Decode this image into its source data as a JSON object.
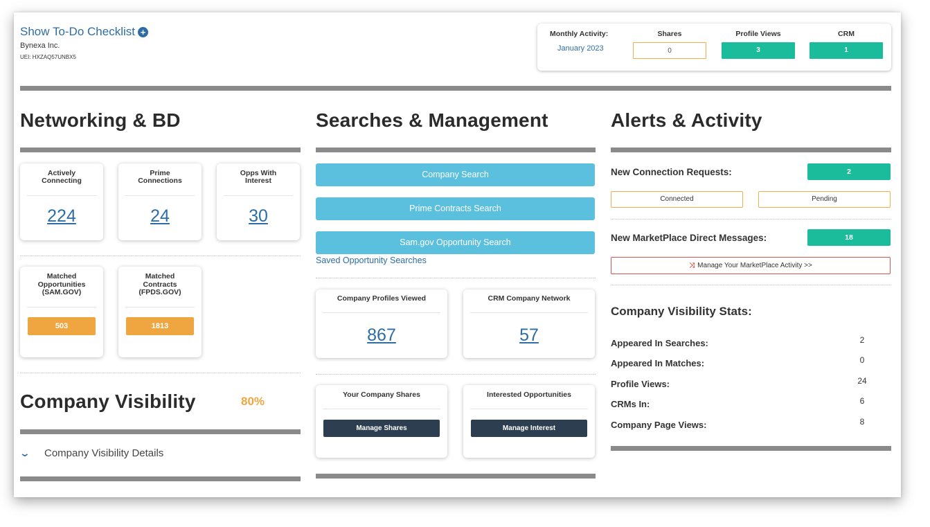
{
  "header": {
    "todo_label": "Show To-Do Checklist",
    "company_name": "Bynexa Inc.",
    "uei": "UEI: HXZAQ57UNBX5"
  },
  "monthly_activity": {
    "label": "Monthly Activity:",
    "month": "January 2023",
    "shares_label": "Shares",
    "shares_value": "0",
    "profile_views_label": "Profile Views",
    "profile_views_value": "3",
    "crm_label": "CRM",
    "crm_value": "1"
  },
  "networking": {
    "title": "Networking & BD",
    "cards": [
      {
        "title_l1": "Actively",
        "title_l2": "Connecting",
        "value": "224"
      },
      {
        "title_l1": "Prime",
        "title_l2": "Connections",
        "value": "24"
      },
      {
        "title_l1": "Opps With",
        "title_l2": "Interest",
        "value": "30"
      }
    ],
    "matched": [
      {
        "title_l1": "Matched",
        "title_l2": "Opportunities",
        "title_l3": "(SAM.GOV)",
        "value": "503"
      },
      {
        "title_l1": "Matched",
        "title_l2": "Contracts",
        "title_l3": "(FPDS.GOV)",
        "value": "1813"
      }
    ]
  },
  "visibility": {
    "title": "Company Visibility",
    "percent": "80%",
    "details_label": "Company Visibility Details"
  },
  "searches": {
    "title": "Searches & Management",
    "company_search": "Company Search",
    "prime_search": "Prime Contracts Search",
    "sam_search": "Sam.gov Opportunity Search",
    "saved_link": "Saved Opportunity Searches",
    "profiles_viewed_label": "Company Profiles Viewed",
    "profiles_viewed_value": "867",
    "crm_network_label": "CRM Company Network",
    "crm_network_value": "57",
    "shares_label": "Your Company Shares",
    "manage_shares": "Manage Shares",
    "interested_label": "Interested Opportunities",
    "manage_interest": "Manage Interest"
  },
  "alerts": {
    "title": "Alerts & Activity",
    "connection_requests_label": "New Connection Requests:",
    "connection_requests_value": "2",
    "connected_label": "Connected",
    "pending_label": "Pending",
    "messages_label": "New MarketPlace Direct Messages:",
    "messages_value": "18",
    "manage_marketplace": "Manage Your MarketPlace Activity >>",
    "stats_title": "Company Visibility Stats:",
    "stats": [
      {
        "label": "Appeared In Searches:",
        "value": "2"
      },
      {
        "label": "Appeared In Matches:",
        "value": "0"
      },
      {
        "label": "Profile Views:",
        "value": "24"
      },
      {
        "label": "CRMs In:",
        "value": "6"
      },
      {
        "label": "Company Page Views:",
        "value": "8"
      }
    ]
  },
  "colors": {
    "link_blue": "#2e6da4",
    "teal": "#1abc9c",
    "orange": "#f0a640",
    "light_blue_button": "#5bc0de",
    "dark_button": "#2c3e50",
    "divider_gray": "#8a8a8a"
  }
}
